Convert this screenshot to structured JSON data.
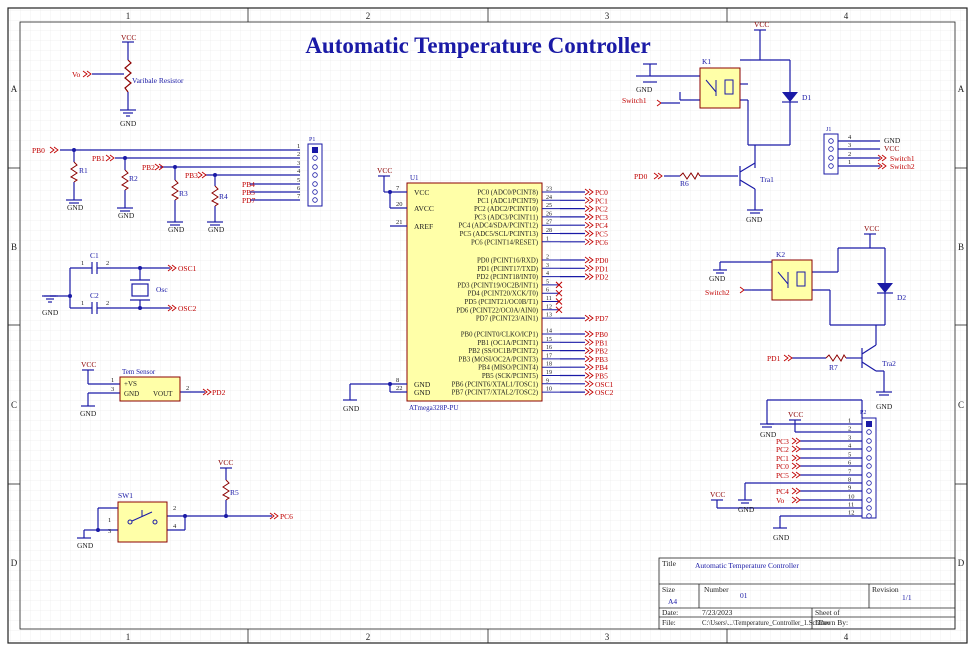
{
  "title": "Automatic Temperature Controller",
  "border": {
    "cols": [
      "1",
      "2",
      "3",
      "4"
    ],
    "rows": [
      "A",
      "B",
      "C",
      "D"
    ]
  },
  "nets": {
    "vcc": "VCC",
    "gnd": "GND",
    "vo": "Vo",
    "pb0": "PB0",
    "pb1": "PB1",
    "pb2": "PB2",
    "pb3": "PB3",
    "pb4": "PB4",
    "pb5": "PB5",
    "pd7": "PD7",
    "osc1": "OSC1",
    "osc2": "OSC2",
    "pd2": "PD2",
    "pc6": "PC6",
    "pd0": "PD0",
    "pd1": "PD1",
    "switch1": "Switch1",
    "switch2": "Switch2",
    "pc0": "PC0",
    "pc1": "PC1",
    "pc2": "PC2",
    "pc3": "PC3",
    "pc4": "PC4",
    "pc5": "PC5",
    "pd2b": "PD2"
  },
  "components": {
    "variable_resistor": "Varibale Resistor",
    "p1": "P1",
    "r1": "R1",
    "r2": "R2",
    "r3": "R3",
    "r4": "R4",
    "r5": "R5",
    "r6": "R6",
    "r7": "R7",
    "c1": "C1",
    "c2": "C2",
    "osc": "Osc",
    "tem_sensor": "Tem Sensor",
    "tem_pins": {
      "vs": "+VS",
      "gnd": "GND",
      "vout": "VOUT"
    },
    "sw1": "SW1",
    "u1": "U1",
    "u1_part": "ATmega328P-PU",
    "k1": "K1",
    "k2": "K2",
    "d1": "D1",
    "d2": "D2",
    "tra1": "Tra1",
    "tra2": "Tra2",
    "p2": "P2",
    "j": "J1"
  },
  "mcu": {
    "left_pins": [
      {
        "num": "7",
        "name": "VCC"
      },
      {
        "num": "20",
        "name": "AVCC"
      },
      {
        "num": "21",
        "name": "AREF"
      },
      {
        "num": "8",
        "name": "GND"
      },
      {
        "num": "22",
        "name": "GND"
      }
    ],
    "right_pins": [
      {
        "num": "23",
        "name": "PC0 (ADC0/PCINT8)",
        "net": "PC0"
      },
      {
        "num": "24",
        "name": "PC1 (ADC1/PCINT9)",
        "net": "PC1"
      },
      {
        "num": "25",
        "name": "PC2 (ADC2/PCINT10)",
        "net": "PC2"
      },
      {
        "num": "26",
        "name": "PC3 (ADC3/PCINT11)",
        "net": "PC3"
      },
      {
        "num": "27",
        "name": "PC4 (ADC4/SDA/PCINT12)",
        "net": "PC4"
      },
      {
        "num": "28",
        "name": "PC5 (ADC5/SCL/PCINT13)",
        "net": "PC5"
      },
      {
        "num": "1",
        "name": "PC6 (PCINT14/RESET)",
        "net": "PC6"
      },
      {
        "num": "2",
        "name": "PD0 (PCINT16/RXD)",
        "net": "PD0"
      },
      {
        "num": "3",
        "name": "PD1 (PCINT17/TXD)",
        "net": "PD1"
      },
      {
        "num": "4",
        "name": "PD2 (PCINT18/INT0)",
        "net": "PD2"
      },
      {
        "num": "5",
        "name": "PD3 (PCINT19/OC2B/INT1)",
        "net": ""
      },
      {
        "num": "6",
        "name": "PD4 (PCINT20/XCK/T0)",
        "net": ""
      },
      {
        "num": "11",
        "name": "PD5 (PCINT21/OC0B/T1)",
        "net": ""
      },
      {
        "num": "12",
        "name": "PD6 (PCINT22/OC0A/AIN0)",
        "net": ""
      },
      {
        "num": "13",
        "name": "PD7 (PCINT23/AIN1)",
        "net": "PD7"
      },
      {
        "num": "14",
        "name": "PB0 (PCINT0/CLKO/ICP1)",
        "net": "PB0"
      },
      {
        "num": "15",
        "name": "PB1 (OC1A/PCINT1)",
        "net": "PB1"
      },
      {
        "num": "16",
        "name": "PB2 (SS/OC1B/PCINT2)",
        "net": "PB2"
      },
      {
        "num": "17",
        "name": "PB3 (MOSI/OC2A/PCINT3)",
        "net": "PB3"
      },
      {
        "num": "18",
        "name": "PB4 (MISO/PCINT4)",
        "net": "PB4"
      },
      {
        "num": "19",
        "name": "PB5 (SCK/PCINT5)",
        "net": "PB5"
      },
      {
        "num": "9",
        "name": "PB6 (PCINT6/XTAL1/TOSC1)",
        "net": "OSC1"
      },
      {
        "num": "10",
        "name": "PB7 (PCINT7/XTAL2/TOSC2)",
        "net": "OSC2"
      }
    ]
  },
  "p1_pins": [
    "1",
    "2",
    "3",
    "4",
    "5",
    "6",
    "7"
  ],
  "p2_pins": [
    "1",
    "2",
    "3",
    "4",
    "5",
    "6",
    "7",
    "8",
    "9",
    "10",
    "11",
    "12"
  ],
  "p2_nets": [
    "PC3",
    "PC2",
    "PC1",
    "PC0",
    "PC5",
    "PC4",
    "Vo"
  ],
  "j1_pins": [
    "4",
    "3",
    "2",
    "1"
  ],
  "j1_nets": [
    "GND",
    "VCC",
    "Switch1",
    "Switch2"
  ],
  "pin_numbers": {
    "one": "1",
    "two": "2",
    "three": "3",
    "four": "4"
  },
  "title_block": {
    "title_label": "Title",
    "title_value": "Automatic Temperature Controller",
    "size_label": "Size",
    "size_value": "A4",
    "number_label": "Number",
    "number_value": "01",
    "revision_label": "Revision",
    "revision_value": "1/1",
    "date_label": "Date:",
    "date_value": "7/23/2023",
    "sheet_label": "Sheet   of",
    "file_label": "File:",
    "file_value": "C:\\Users\\...\\Temperature_Controller_1.SchDoc",
    "drawn_label": "Drawn By:"
  },
  "colors": {
    "wire": "#1a1aa6",
    "net_label": "#c00000",
    "body_fill": "#ffffa8",
    "body_stroke": "#8b0000",
    "title": "#1a1aa6",
    "grid": "#e7e7e7"
  }
}
